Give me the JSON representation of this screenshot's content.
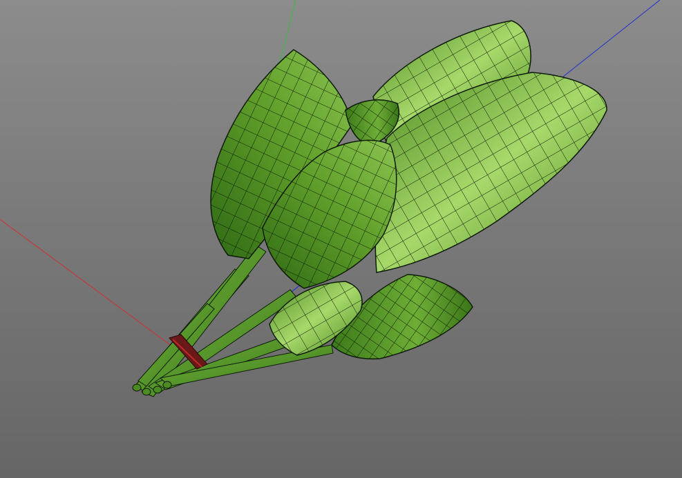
{
  "viewport": {
    "background_top": "#8c8c8c",
    "background_bottom": "#666666"
  },
  "axes": {
    "x_color": "#d23030",
    "y_color": "#30c040",
    "z_color": "#2030d0"
  },
  "model": {
    "leaf_color_dark": "#2f6a14",
    "leaf_color_mid": "#5f9e2a",
    "leaf_color_light": "#a7d86a",
    "wireframe_color": "#0d1a05",
    "tie_color": "#8a1a1a"
  }
}
